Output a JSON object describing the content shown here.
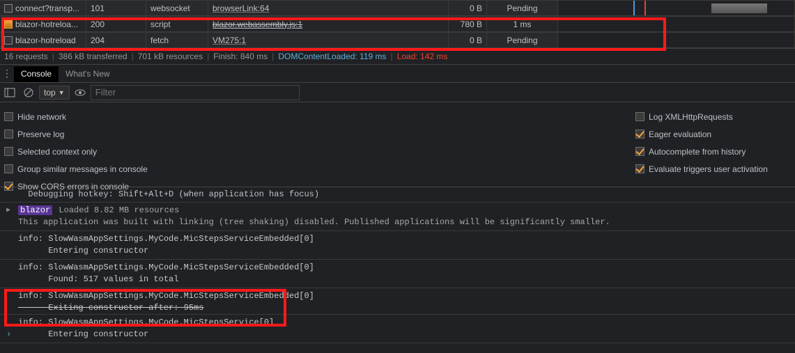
{
  "network": {
    "rows": [
      {
        "name": "connect?transp...",
        "status": "101",
        "type": "websocket",
        "initiator": "browserLink:64",
        "size": "0 B",
        "time": "Pending",
        "strike": false,
        "chkPending": false
      },
      {
        "name": "blazor-hotreloa...",
        "status": "200",
        "type": "script",
        "initiator": "blazor.webassembly.js:1",
        "size": "780 B",
        "time": "1 ms",
        "strike": true,
        "chkPending": true
      },
      {
        "name": "blazor-hotreload",
        "status": "204",
        "type": "fetch",
        "initiator": "VM275:1",
        "size": "0 B",
        "time": "Pending",
        "strike": false,
        "chkPending": false
      }
    ]
  },
  "summary": {
    "requests": "16 requests",
    "transferred": "386 kB transferred",
    "resources": "701 kB resources",
    "finish": "Finish: 840 ms",
    "dcl": "DOMContentLoaded: 119 ms",
    "load": "Load: 142 ms"
  },
  "tabs": {
    "console": "Console",
    "whatsnew": "What's New"
  },
  "toolbar": {
    "top": "top",
    "filterPlaceholder": "Filter"
  },
  "settings": {
    "left": [
      {
        "label": "Hide network",
        "checked": false
      },
      {
        "label": "Preserve log",
        "checked": false
      },
      {
        "label": "Selected context only",
        "checked": false
      },
      {
        "label": "Group similar messages in console",
        "checked": false
      },
      {
        "label": "Show CORS errors in console",
        "checked": true
      }
    ],
    "right": [
      {
        "label": "Log XMLHttpRequests",
        "checked": false
      },
      {
        "label": "Eager evaluation",
        "checked": true
      },
      {
        "label": "Autocomplete from history",
        "checked": true
      },
      {
        "label": "Evaluate triggers user activation",
        "checked": true
      }
    ]
  },
  "logs": {
    "l1": "  Debugging hotkey: Shift+Alt+D (when application has focus)",
    "l2_badge": "blazor",
    "l2_rest": " Loaded 8.82 MB resources",
    "l2b": "This application was built with linking (tree shaking) disabled. Published applications will be significantly smaller.",
    "l3a": "info: SlowWasmAppSettings.MyCode.MicStepsServiceEmbedded[0]",
    "l3b": "      Entering constructor",
    "l4a": "info: SlowWasmAppSettings.MyCode.MicStepsServiceEmbedded[0]",
    "l4b": "      Found: 517 values in total",
    "l5a": "info: SlowWasmAppSettings.MyCode.MicStepsServiceEmbedded[0]",
    "l5b": "      Exiting constructor after: 95ms",
    "l6a": "info: SlowWasmAppSettings.MyCode.MicStepsService[0]",
    "l6b": "      Entering constructor"
  }
}
